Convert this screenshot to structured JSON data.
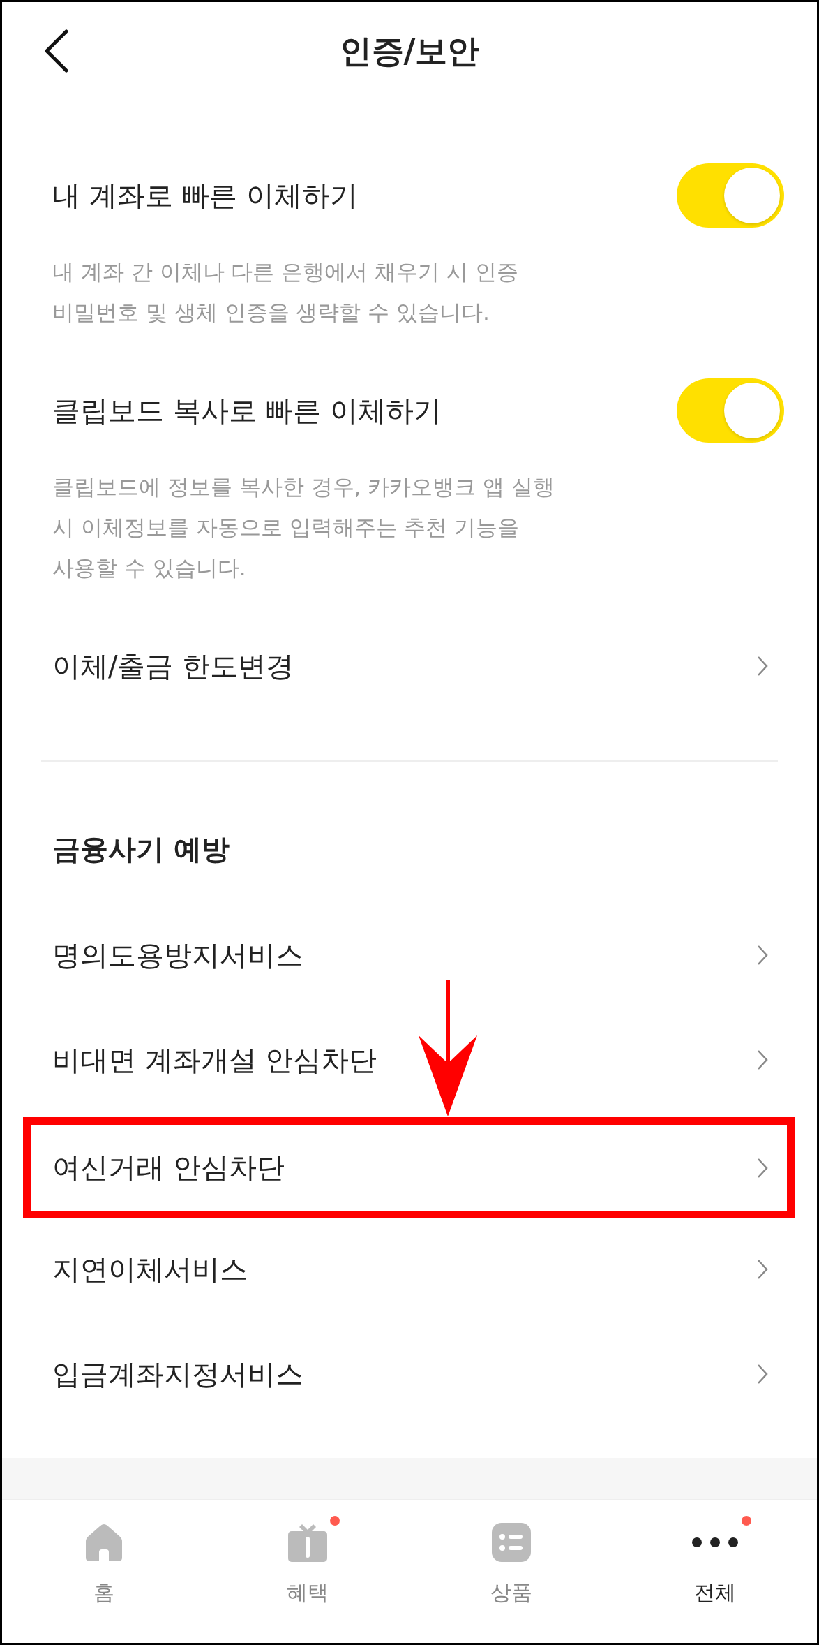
{
  "header": {
    "title": "인증/보안"
  },
  "transfer_settings": [
    {
      "kind": "toggle",
      "label": "내 계좌로 빠른 이체하기",
      "on": true,
      "description": [
        "내 계좌 간 이체나 다른 은행에서 채우기 시 인증",
        "비밀번호 및 생체 인증을 생략할 수 있습니다."
      ]
    },
    {
      "kind": "toggle",
      "label": "클립보드 복사로 빠른 이체하기",
      "on": true,
      "description": [
        "클립보드에 정보를 복사한 경우, 카카오뱅크 앱 실행",
        "시 이체정보를 자동으로 입력해주는 추천 기능을",
        "사용할 수 있습니다."
      ]
    },
    {
      "kind": "link",
      "label": "이체/출금 한도변경"
    }
  ],
  "fraud_prevention": {
    "title": "금융사기 예방",
    "items": [
      {
        "label": "명의도용방지서비스",
        "highlighted": false
      },
      {
        "label": "비대면 계좌개설 안심차단",
        "highlighted": false
      },
      {
        "label": "여신거래 안심차단",
        "highlighted": true
      },
      {
        "label": "지연이체서비스",
        "highlighted": false
      },
      {
        "label": "입금계좌지정서비스",
        "highlighted": false
      }
    ]
  },
  "tab_bar": [
    {
      "kind": "home",
      "label": "홈",
      "selected": false,
      "badge": false
    },
    {
      "kind": "gift",
      "label": "혜택",
      "selected": false,
      "badge": true
    },
    {
      "kind": "products",
      "label": "상품",
      "selected": false,
      "badge": false
    },
    {
      "kind": "more",
      "label": "전체",
      "selected": true,
      "badge": true
    }
  ]
}
